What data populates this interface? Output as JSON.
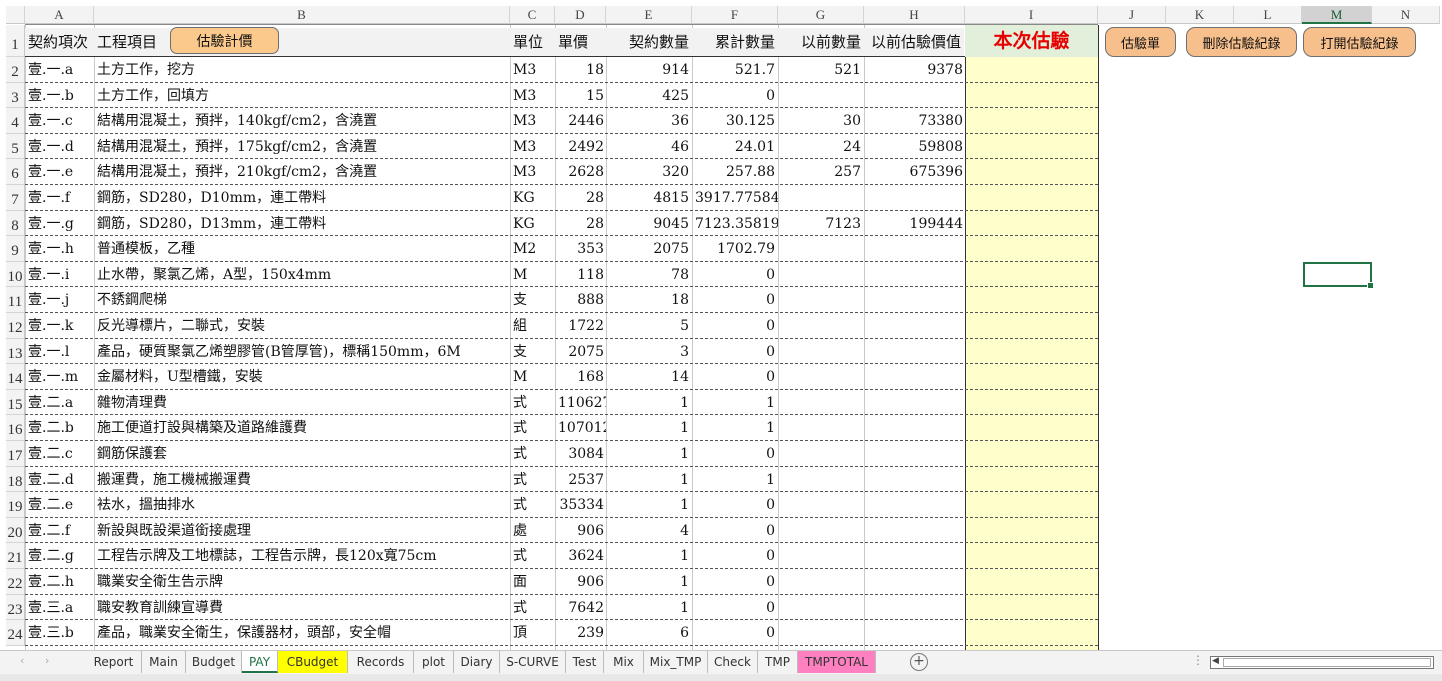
{
  "columns": [
    "A",
    "B",
    "C",
    "D",
    "E",
    "F",
    "G",
    "H",
    "I",
    "J",
    "K",
    "L",
    "M",
    "N"
  ],
  "selected_column": "M",
  "header_row": {
    "row_number": "1",
    "a": "契約項次",
    "b": "工程項目",
    "c": "單位",
    "d": "單價",
    "e": "契約數量",
    "f": "累計數量",
    "g": "以前數量",
    "h": "以前估驗價值",
    "i": "本次估驗"
  },
  "buttons": {
    "estimate_calc": "估驗計價",
    "estimate_sheet": "估驗單",
    "delete_records": "刪除估驗紀錄",
    "open_records": "打開估驗紀錄"
  },
  "rows": [
    {
      "n": "2",
      "a": "壹.一.a",
      "b": "土方工作，挖方",
      "c": "M3",
      "d": "18",
      "e": "914",
      "f": "521.7",
      "g": "521",
      "h": "9378"
    },
    {
      "n": "3",
      "a": "壹.一.b",
      "b": "土方工作，回填方",
      "c": "M3",
      "d": "15",
      "e": "425",
      "f": "0",
      "g": "",
      "h": ""
    },
    {
      "n": "4",
      "a": "壹.一.c",
      "b": "結構用混凝土，預拌，140kgf/cm2，含澆置",
      "c": "M3",
      "d": "2446",
      "e": "36",
      "f": "30.125",
      "g": "30",
      "h": "73380"
    },
    {
      "n": "5",
      "a": "壹.一.d",
      "b": "結構用混凝土，預拌，175kgf/cm2，含澆置",
      "c": "M3",
      "d": "2492",
      "e": "46",
      "f": "24.01",
      "g": "24",
      "h": "59808"
    },
    {
      "n": "6",
      "a": "壹.一.e",
      "b": "結構用混凝土，預拌，210kgf/cm2，含澆置",
      "c": "M3",
      "d": "2628",
      "e": "320",
      "f": "257.88",
      "g": "257",
      "h": "675396"
    },
    {
      "n": "7",
      "a": "壹.一.f",
      "b": "鋼筋，SD280，D10mm，連工帶料",
      "c": "KG",
      "d": "28",
      "e": "4815",
      "f": "3917.77584",
      "g": "",
      "h": ""
    },
    {
      "n": "8",
      "a": "壹.一.g",
      "b": "鋼筋，SD280，D13mm，連工帶料",
      "c": "KG",
      "d": "28",
      "e": "9045",
      "f": "7123.358198",
      "g": "7123",
      "h": "199444"
    },
    {
      "n": "9",
      "a": "壹.一.h",
      "b": "普通模板，乙種",
      "c": "M2",
      "d": "353",
      "e": "2075",
      "f": "1702.79",
      "g": "",
      "h": ""
    },
    {
      "n": "10",
      "a": "壹.一.i",
      "b": "止水帶，聚氯乙烯，A型，150x4mm",
      "c": "M",
      "d": "118",
      "e": "78",
      "f": "0",
      "g": "",
      "h": ""
    },
    {
      "n": "11",
      "a": "壹.一.j",
      "b": "不銹鋼爬梯",
      "c": "支",
      "d": "888",
      "e": "18",
      "f": "0",
      "g": "",
      "h": ""
    },
    {
      "n": "12",
      "a": "壹.一.k",
      "b": "反光導標片，二聯式，安裝",
      "c": "組",
      "d": "1722",
      "e": "5",
      "f": "0",
      "g": "",
      "h": ""
    },
    {
      "n": "13",
      "a": "壹.一.l",
      "b": "產品，硬質聚氯乙烯塑膠管(B管厚管)，標稱150mm，6M",
      "c": "支",
      "d": "2075",
      "e": "3",
      "f": "0",
      "g": "",
      "h": ""
    },
    {
      "n": "14",
      "a": "壹.一.m",
      "b": "金屬材料，U型槽鐵，安裝",
      "c": "M",
      "d": "168",
      "e": "14",
      "f": "0",
      "g": "",
      "h": ""
    },
    {
      "n": "15",
      "a": "壹.二.a",
      "b": "雜物清理費",
      "c": "式",
      "d": "110627",
      "e": "1",
      "f": "1",
      "g": "",
      "h": ""
    },
    {
      "n": "16",
      "a": "壹.二.b",
      "b": "施工便道打設與構築及道路維護費",
      "c": "式",
      "d": "107012",
      "e": "1",
      "f": "1",
      "g": "",
      "h": ""
    },
    {
      "n": "17",
      "a": "壹.二.c",
      "b": "鋼筋保護套",
      "c": "式",
      "d": "3084",
      "e": "1",
      "f": "0",
      "g": "",
      "h": ""
    },
    {
      "n": "18",
      "a": "壹.二.d",
      "b": "搬運費，施工機械搬運費",
      "c": "式",
      "d": "2537",
      "e": "1",
      "f": "1",
      "g": "",
      "h": ""
    },
    {
      "n": "19",
      "a": "壹.二.e",
      "b": "袪水，搵抽排水",
      "c": "式",
      "d": "35334",
      "e": "1",
      "f": "0",
      "g": "",
      "h": ""
    },
    {
      "n": "20",
      "a": "壹.二.f",
      "b": "新設與既設渠道銜接處理",
      "c": "處",
      "d": "906",
      "e": "4",
      "f": "0",
      "g": "",
      "h": ""
    },
    {
      "n": "21",
      "a": "壹.二.g",
      "b": "工程告示牌及工地標誌，工程告示牌，長120x寬75cm",
      "c": "式",
      "d": "3624",
      "e": "1",
      "f": "0",
      "g": "",
      "h": ""
    },
    {
      "n": "22",
      "a": "壹.二.h",
      "b": "職業安全衛生告示牌",
      "c": "面",
      "d": "906",
      "e": "1",
      "f": "0",
      "g": "",
      "h": ""
    },
    {
      "n": "23",
      "a": "壹.三.a",
      "b": "職安教育訓練宣導費",
      "c": "式",
      "d": "7642",
      "e": "1",
      "f": "0",
      "g": "",
      "h": ""
    },
    {
      "n": "24",
      "a": "壹.三.b",
      "b": "產品，職業安全衛生，保護器材，頭部，安全帽",
      "c": "頂",
      "d": "239",
      "e": "6",
      "f": "0",
      "g": "",
      "h": ""
    }
  ],
  "sheet_tabs": [
    {
      "label": "Report",
      "style": "normal"
    },
    {
      "label": "Main",
      "style": "normal"
    },
    {
      "label": "Budget",
      "style": "normal"
    },
    {
      "label": "PAY",
      "style": "active"
    },
    {
      "label": "CBudget",
      "style": "yellow"
    },
    {
      "label": "Records",
      "style": "normal"
    },
    {
      "label": "plot",
      "style": "normal"
    },
    {
      "label": "Diary",
      "style": "normal"
    },
    {
      "label": "S-CURVE",
      "style": "normal"
    },
    {
      "label": "Test",
      "style": "normal"
    },
    {
      "label": "Mix",
      "style": "normal"
    },
    {
      "label": "Mix_TMP",
      "style": "normal"
    },
    {
      "label": "Check",
      "style": "normal"
    },
    {
      "label": "TMP",
      "style": "normal"
    },
    {
      "label": "TMPTOTAL",
      "style": "pink"
    }
  ],
  "add_sheet_symbol": "+",
  "colors": {
    "accent": "#217346",
    "highlight_col": "#ffffcc",
    "button": "#fbc98b",
    "estimate_title": "#e60000",
    "tab_pink": "#ff80c0",
    "tab_yellow": "#ffff00"
  }
}
